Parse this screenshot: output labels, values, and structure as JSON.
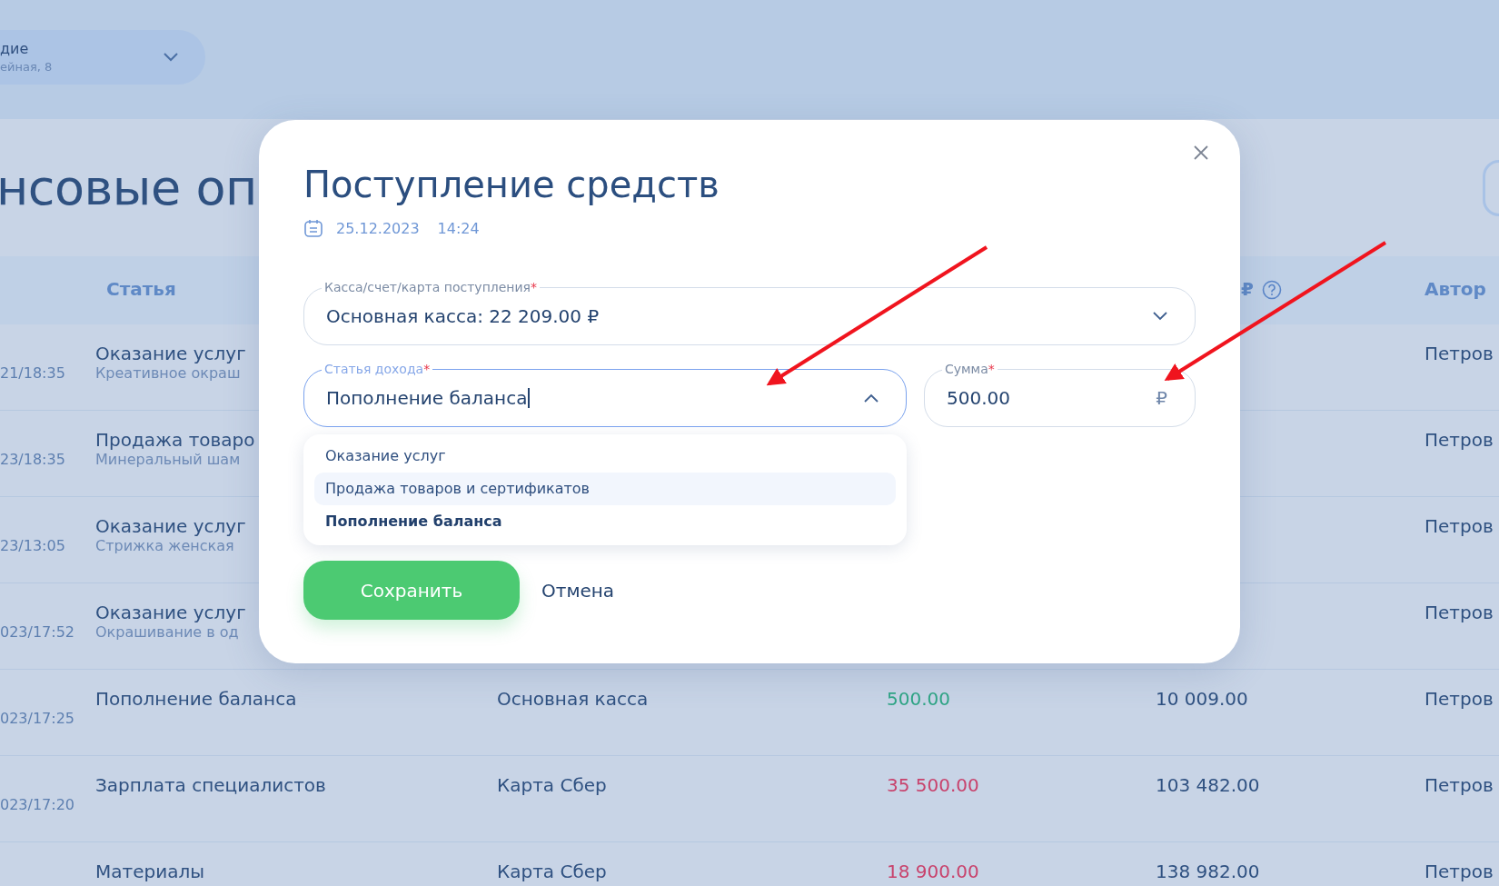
{
  "location_selector": {
    "name": "дие",
    "address": "ейная, 8"
  },
  "page_title": "нсовые оп",
  "table": {
    "columns": [
      {
        "label": "Статья"
      },
      {
        "label": "₽",
        "help": true
      },
      {
        "label": "Автор"
      }
    ],
    "rows": [
      {
        "date": "21/18:35",
        "article": "Оказание услуг",
        "detail": "Креативное окраш",
        "author": "Петров"
      },
      {
        "date": "23/18:35",
        "article": "Продажа товаро",
        "detail": "Минеральный шам",
        "author": "Петров"
      },
      {
        "date": "23/13:05",
        "article": "Оказание услуг",
        "detail": "Стрижка женская",
        "author": "Петров"
      },
      {
        "date": "023/17:52",
        "article": "Оказание услуг",
        "detail": "Окрашивание в од",
        "author": "Петров"
      },
      {
        "date": "023/17:25",
        "article": "Пополнение баланса",
        "account": "Основная касса",
        "amount": "500.00",
        "color": "#2fa585",
        "balance": "10 009.00",
        "author": "Петров"
      },
      {
        "date": "023/17:20",
        "article": "Зарплата специалистов",
        "account": "Карта Сбер",
        "amount": "35 500.00",
        "color": "#c8426c",
        "balance": "103 482.00",
        "author": "Петров"
      },
      {
        "article": "Материалы",
        "account": "Карта Сбер",
        "amount": "18 900.00",
        "color": "#c8426c",
        "balance": "138 982.00",
        "author": "Петров"
      }
    ]
  },
  "modal": {
    "title": "Поступление средств",
    "date": "25.12.2023",
    "time": "14:24",
    "account_field": {
      "label": "Касса/счет/карта поступления",
      "required_mark": "*",
      "value": "Основная касса: 22 209.00 ₽",
      "expanded": false,
      "focused": false
    },
    "income_field": {
      "label": "Статья дохода",
      "required_mark": "*",
      "value": "Пополнение баланса",
      "expanded": true,
      "focused": true
    },
    "sum_field": {
      "label": "Сумма",
      "required_mark": "*",
      "value": "500.00",
      "suffix": "₽"
    },
    "options": [
      {
        "label": "Оказание услуг",
        "highlighted": false,
        "selected": false
      },
      {
        "label": "Продажа товаров и сертификатов",
        "highlighted": true,
        "selected": false
      },
      {
        "label": "Пополнение баланса",
        "highlighted": false,
        "selected": true
      }
    ],
    "buttons": [
      {
        "label": "Сохранить",
        "kind": "primary"
      },
      {
        "label": "Отмена",
        "kind": "secondary"
      }
    ]
  }
}
